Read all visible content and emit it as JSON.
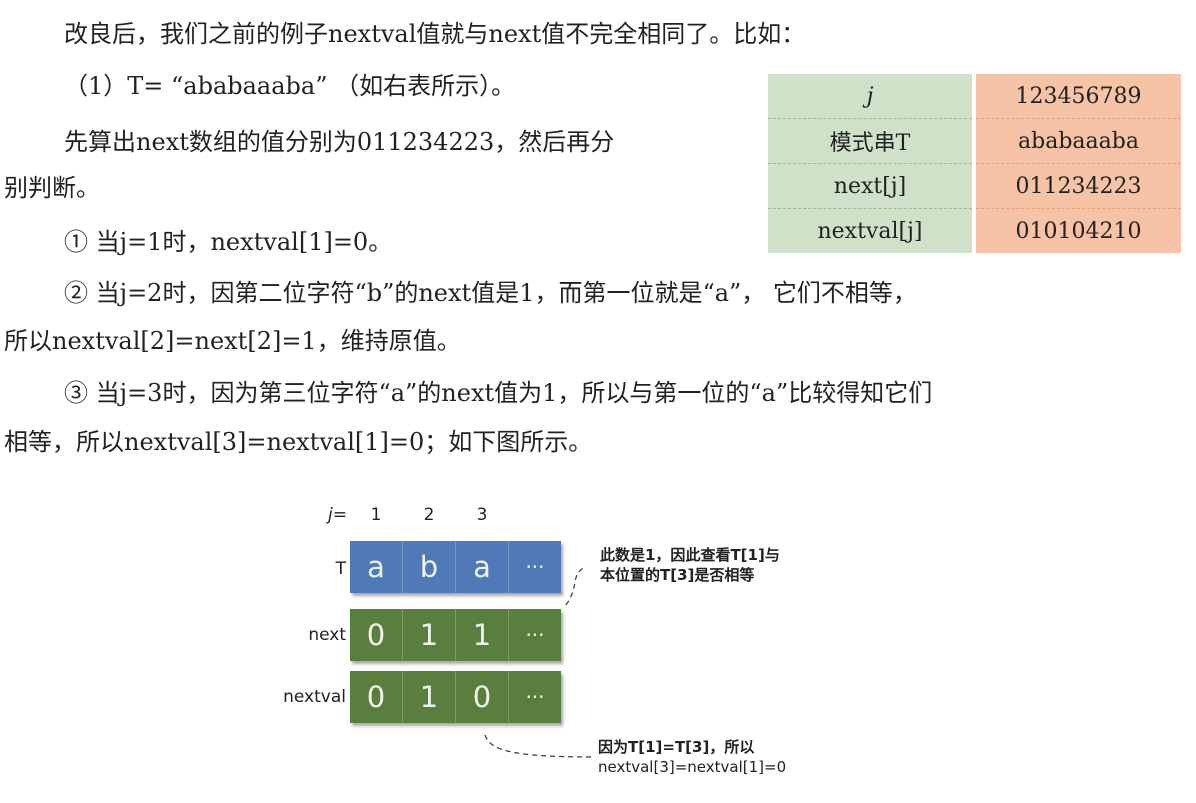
{
  "paragraphs": {
    "p1": "改良后，我们之前的例子nextval值就与next值不完全相同了。比如：",
    "p2": "（1）T= “ababaaaba” （如右表所示）。",
    "p3": "先算出next数组的值分别为011234223，然后再分",
    "p4": "别判断。",
    "p5": "① 当j=1时，nextval[1]=0。",
    "p6": "② 当j=2时，因第二位字符“b”的next值是1，而第一位就是“a”， 它们不相等，",
    "p7": "所以nextval[2]=next[2]=1，维持原值。",
    "p8": "③ 当j=3时，因为第三位字符“a”的next值为1，所以与第一位的“a”比较得知它们",
    "p9": "相等，所以nextval[3]=nextval[1]=0；如下图所示。"
  },
  "table": {
    "rows": [
      {
        "label": "j",
        "value": "123456789"
      },
      {
        "label": "模式串T",
        "value": "ababaaaba"
      },
      {
        "label": "next[j]",
        "value": "011234223"
      },
      {
        "label": "nextval[j]",
        "value": "010104210"
      }
    ]
  },
  "figure": {
    "j_label": "j=",
    "j_numbers": [
      "1",
      "2",
      "3"
    ],
    "rows": [
      {
        "label": "T",
        "cells": [
          "a",
          "b",
          "a",
          "···"
        ]
      },
      {
        "label": "next",
        "cells": [
          "0",
          "1",
          "1",
          "···"
        ]
      },
      {
        "label": "nextval",
        "cells": [
          "0",
          "1",
          "0",
          "···"
        ]
      }
    ],
    "note_top_line1": "此数是1，因此查看T[1]与",
    "note_top_line2": "本位置的T[3]是否相等",
    "note_bottom_line1": "因为T[1]=T[3]，所以",
    "note_bottom_line2": "nextval[3]=nextval[1]=0"
  },
  "colors": {
    "table_label_bg": "#cfe2c9",
    "table_value_bg": "#f6c3a7",
    "cell_blue": "#4f7ab7",
    "cell_green": "#597e3e"
  }
}
